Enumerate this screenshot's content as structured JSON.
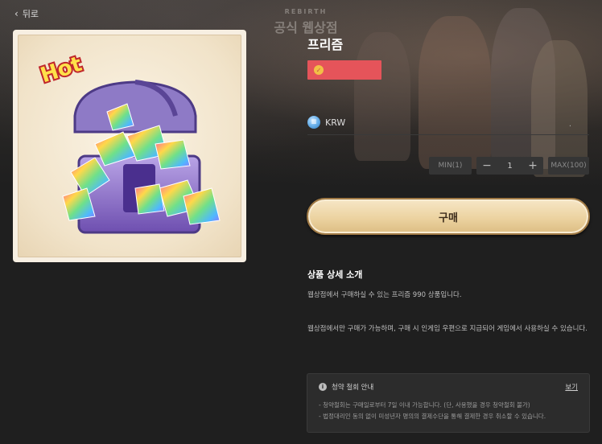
{
  "nav": {
    "back_label": "뒤로"
  },
  "background": {
    "logo_sub": "REBIRTH",
    "logo_main": "공식 웹상점"
  },
  "product": {
    "badge": "Hot",
    "title": "프리즘",
    "currency": "KRW",
    "price_placeholder": "."
  },
  "quantity": {
    "min_label": "MIN(1)",
    "minus": "−",
    "value": "1",
    "plus": "+",
    "max_label": "MAX(100)"
  },
  "buy_label": "구매",
  "details": {
    "title": "상품 상세 소개",
    "line1": "웹상점에서 구매하실 수 있는 프리즘 990 상품입니다.",
    "line2": "웹상점에서만 구매가 가능하며, 구매 시 인게임 우편으로 지급되어 게임에서 사용하실 수 있습니다."
  },
  "notice": {
    "title": "청약 철회 안내",
    "link": "보기",
    "items": [
      "- 청약철회는 구매일로부터 7일 이내 가능합니다. (단, 사용했을 경우 청약철회 불가)",
      "- 법정대리인 동의 없이 미성년자 명의의 결제수단을 통해 결제한 경우 취소할 수 있습니다."
    ]
  },
  "colors": {
    "accent_tag": "#e5545a",
    "button_gold": "#ecd3a1",
    "background": "#1f1f1f"
  }
}
